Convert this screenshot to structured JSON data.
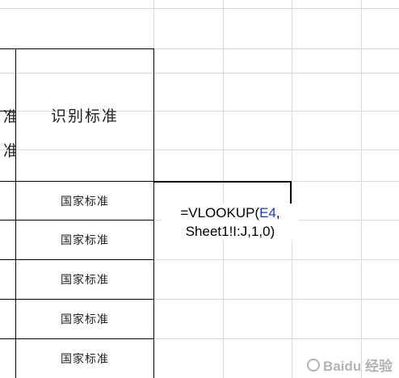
{
  "sheet": {
    "header_cell": "识别标准",
    "left_edge_glyph_top": "准",
    "left_edge_glyph_bottom": "准",
    "rows": [
      {
        "value": "国家标准"
      },
      {
        "value": "国家标准"
      },
      {
        "value": "国家标准"
      },
      {
        "value": "国家标准"
      },
      {
        "value": "国家标准"
      }
    ],
    "formula": {
      "prefix": "=VLOOKUP(",
      "reference": "E4",
      "after_ref": ",",
      "line2": "Sheet1!I:J,1,0)"
    },
    "watermark": "Baidu 经验"
  },
  "colors": {
    "gridline": "#d9d9d9",
    "border": "#000000",
    "cell_reference": "#1f3aa6"
  }
}
